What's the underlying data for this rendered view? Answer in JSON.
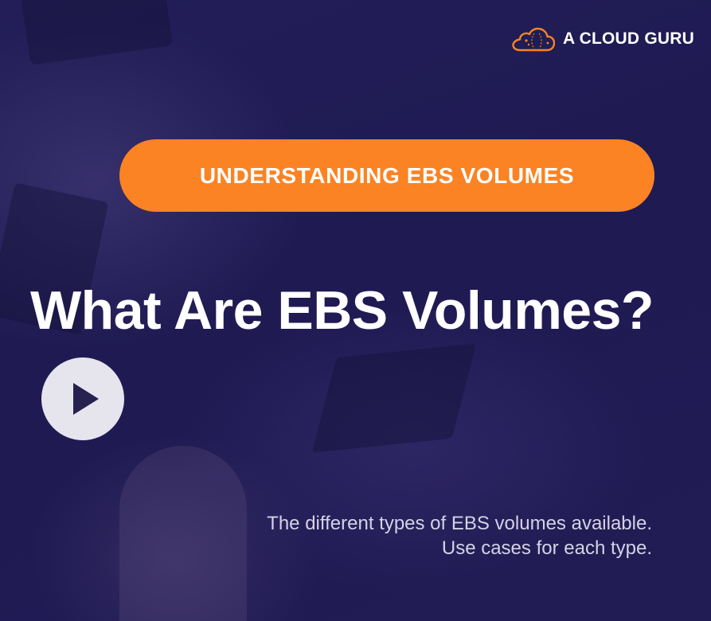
{
  "logo": {
    "text": "A CLOUD GURU",
    "icon": "cloud-logo-icon",
    "accent_color": "#fb8323"
  },
  "course_banner": {
    "label": "UNDERSTANDING EBS VOLUMES",
    "color": "#fb8323"
  },
  "lesson": {
    "title": "What Are EBS Volumes?"
  },
  "player": {
    "play_icon": "play-icon"
  },
  "description": {
    "lines": [
      "The different types of EBS volumes available.",
      "Use cases for each type."
    ]
  },
  "colors": {
    "background": "#1e1a4d",
    "play_button": "#e6e5ee"
  }
}
